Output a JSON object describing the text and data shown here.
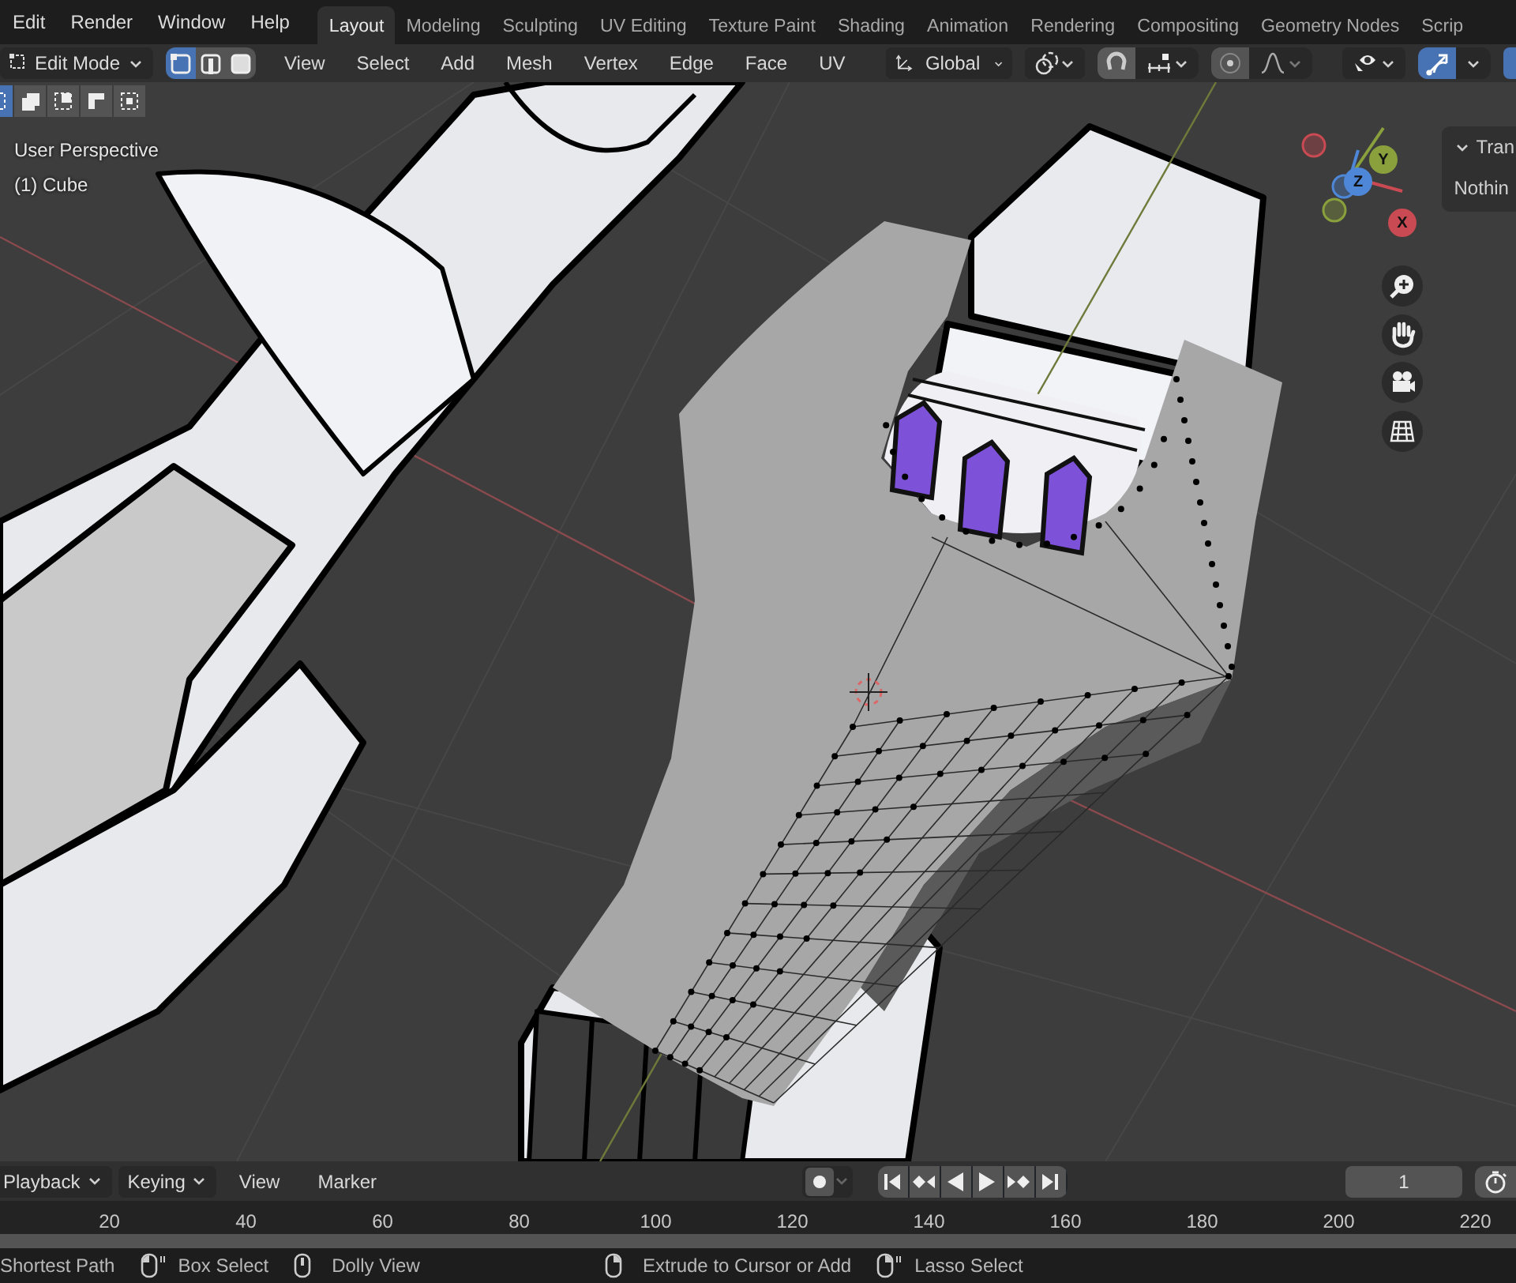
{
  "menu_bar": {
    "menus": [
      "Edit",
      "Render",
      "Window",
      "Help"
    ],
    "workspaces": [
      {
        "label": "Layout",
        "selected": true
      },
      {
        "label": "Modeling",
        "selected": false
      },
      {
        "label": "Sculpting",
        "selected": false
      },
      {
        "label": "UV Editing",
        "selected": false
      },
      {
        "label": "Texture Paint",
        "selected": false
      },
      {
        "label": "Shading",
        "selected": false
      },
      {
        "label": "Animation",
        "selected": false
      },
      {
        "label": "Rendering",
        "selected": false
      },
      {
        "label": "Compositing",
        "selected": false
      },
      {
        "label": "Geometry Nodes",
        "selected": false
      },
      {
        "label": "Scrip",
        "selected": false
      }
    ]
  },
  "header": {
    "mode": "Edit Mode",
    "select_modes": [
      {
        "selected": true
      },
      {
        "selected": false
      },
      {
        "selected": false
      }
    ],
    "menus": [
      "View",
      "Select",
      "Add",
      "Mesh",
      "Vertex",
      "Edge",
      "Face",
      "UV"
    ],
    "orientation": "Global",
    "gizmo_toggle": {
      "on": true
    }
  },
  "tool_settings": {
    "selection_modes": [
      {
        "selected": true
      },
      {
        "selected": false
      },
      {
        "selected": false
      },
      {
        "selected": false
      },
      {
        "selected": false
      }
    ]
  },
  "viewport": {
    "view_name": "User Perspective",
    "object_label": "(1) Cube",
    "gizmo_axes": [
      "X",
      "Y",
      "Z"
    ],
    "sidebar": {
      "panel_title": "Tran",
      "text": "Nothin"
    }
  },
  "timeline": {
    "menus": [
      {
        "label": "Playback",
        "dropdown": true
      },
      {
        "label": "Keying",
        "dropdown": true
      },
      {
        "label": "View",
        "dropdown": false
      },
      {
        "label": "Marker",
        "dropdown": false
      }
    ],
    "current_frame": "1",
    "ruler": [
      "20",
      "40",
      "60",
      "80",
      "100",
      "120",
      "140",
      "160",
      "180",
      "200",
      "220"
    ]
  },
  "status_bar": {
    "left": [
      {
        "text": "Shortest Path",
        "kind": "none"
      },
      {
        "text": "Box Select",
        "kind": "leftdrag"
      },
      {
        "text": "Dolly View",
        "kind": "middle"
      }
    ],
    "center": [
      {
        "text": "Extrude to Cursor or Add",
        "kind": "right"
      },
      {
        "text": "Lasso Select",
        "kind": "rightdrag"
      }
    ]
  }
}
